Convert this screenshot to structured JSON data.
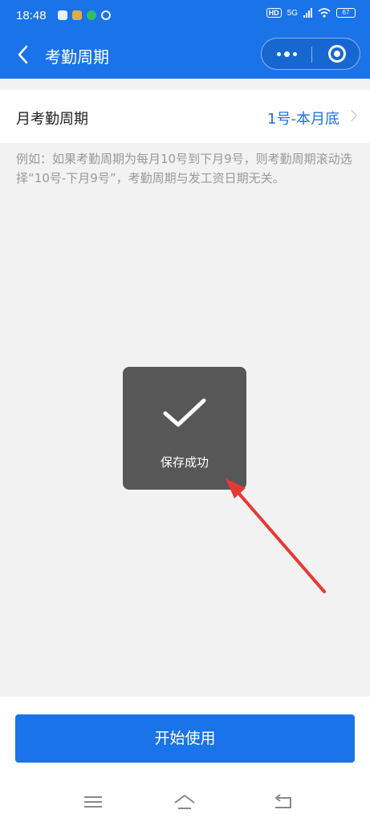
{
  "status_bar": {
    "time": "18:48",
    "hd": "HD",
    "network": "5G",
    "battery": "67"
  },
  "nav": {
    "title": "考勤周期",
    "back_icon": "chevron-left-icon",
    "more_icon": "more-dots-icon",
    "close_icon": "target-circle-icon"
  },
  "setting": {
    "label": "月考勤周期",
    "value": "1号-本月底"
  },
  "hint": "例如：如果考勤周期为每月10号到下月9号，则考勤周期滚动选择“10号-下月9号”，考勤周期与发工资日期无关。",
  "toast": {
    "icon": "checkmark-icon",
    "message": "保存成功"
  },
  "actions": {
    "start_label": "开始使用"
  },
  "system_nav": {
    "menu_icon": "menu-lines-icon",
    "home_icon": "home-icon",
    "back_icon": "back-return-icon"
  },
  "colors": {
    "primary": "#1a73e8",
    "toast_bg": "#575757",
    "annotation_arrow": "#e53935"
  }
}
